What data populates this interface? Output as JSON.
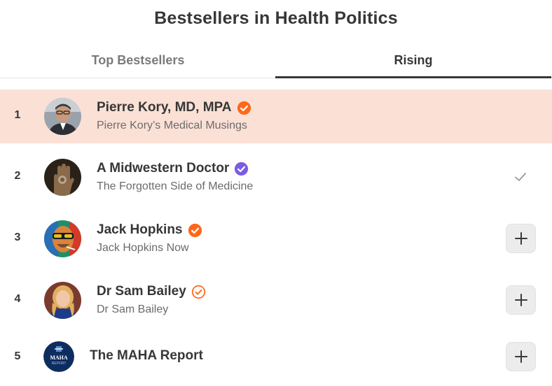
{
  "page": {
    "title": "Bestsellers in Health Politics"
  },
  "tabs": [
    {
      "label": "Top Bestsellers",
      "active": false
    },
    {
      "label": "Rising",
      "active": true
    }
  ],
  "rows": [
    {
      "rank": "1",
      "name": "Pierre Kory, MD, MPA",
      "subtitle": "Pierre Kory’s Medical Musings",
      "badge": "orange-verified-badge-icon",
      "action": "none",
      "highlighted": true
    },
    {
      "rank": "2",
      "name": "A Midwestern Doctor",
      "subtitle": "The Forgotten Side of Medicine",
      "badge": "purple-verified-badge-icon",
      "action": "subscribed-check"
    },
    {
      "rank": "3",
      "name": "Jack Hopkins",
      "subtitle": "Jack Hopkins Now",
      "badge": "orange-verified-badge-icon",
      "action": "add"
    },
    {
      "rank": "4",
      "name": "Dr Sam Bailey",
      "subtitle": "Dr Sam Bailey",
      "badge": "orange-outline-verified-badge-icon",
      "action": "add"
    },
    {
      "rank": "5",
      "name": "The MAHA Report",
      "subtitle": "",
      "badge": "",
      "action": "add",
      "logo_text": [
        "MAHA",
        "REPORT"
      ]
    }
  ],
  "colors": {
    "highlight": "#fbe0d6",
    "orange_badge": "#ff6719",
    "purple_badge": "#7b5ce5",
    "logo_navy": "#0d2d5e"
  }
}
